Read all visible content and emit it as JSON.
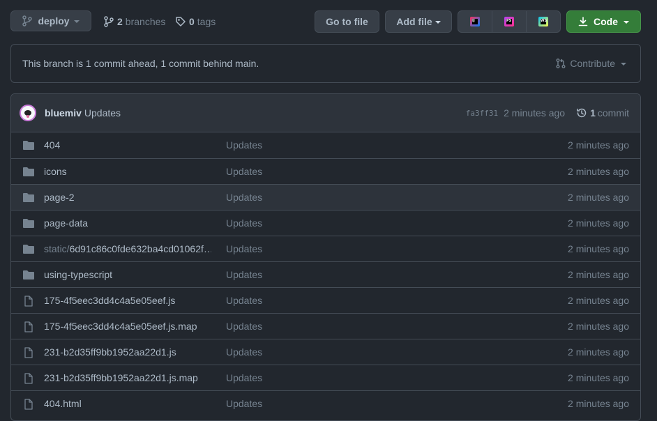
{
  "toolbar": {
    "branch_name": "deploy",
    "branches_count": "2",
    "branches_label": "branches",
    "tags_count": "0",
    "tags_label": "tags",
    "go_to_file": "Go to file",
    "add_file": "Add file",
    "code": "Code",
    "ides": [
      {
        "label": "IJ",
        "color": "#fe315d"
      },
      {
        "label": "PS",
        "color": "#b345f1"
      },
      {
        "label": "WS",
        "color": "#07c3f2"
      }
    ]
  },
  "branch_status": {
    "text": "This branch is 1 commit ahead, 1 commit behind main.",
    "contribute": "Contribute"
  },
  "latest_commit": {
    "author": "bluemiv",
    "message": "Updates",
    "sha": "fa3ff31",
    "age": "2 minutes ago",
    "commit_count": "1",
    "commit_label": "commit"
  },
  "files": [
    {
      "type": "dir",
      "prefix": "",
      "name": "404",
      "message": "Updates",
      "age": "2 minutes ago"
    },
    {
      "type": "dir",
      "prefix": "",
      "name": "icons",
      "message": "Updates",
      "age": "2 minutes ago"
    },
    {
      "type": "dir",
      "prefix": "",
      "name": "page-2",
      "message": "Updates",
      "age": "2 minutes ago"
    },
    {
      "type": "dir",
      "prefix": "",
      "name": "page-data",
      "message": "Updates",
      "age": "2 minutes ago"
    },
    {
      "type": "dir",
      "prefix": "static/",
      "name": "6d91c86c0fde632ba4cd01062f…",
      "message": "Updates",
      "age": "2 minutes ago"
    },
    {
      "type": "dir",
      "prefix": "",
      "name": "using-typescript",
      "message": "Updates",
      "age": "2 minutes ago"
    },
    {
      "type": "file",
      "prefix": "",
      "name": "175-4f5eec3dd4c4a5e05eef.js",
      "message": "Updates",
      "age": "2 minutes ago"
    },
    {
      "type": "file",
      "prefix": "",
      "name": "175-4f5eec3dd4c4a5e05eef.js.map",
      "message": "Updates",
      "age": "2 minutes ago"
    },
    {
      "type": "file",
      "prefix": "",
      "name": "231-b2d35ff9bb1952aa22d1.js",
      "message": "Updates",
      "age": "2 minutes ago"
    },
    {
      "type": "file",
      "prefix": "",
      "name": "231-b2d35ff9bb1952aa22d1.js.map",
      "message": "Updates",
      "age": "2 minutes ago"
    },
    {
      "type": "file",
      "prefix": "",
      "name": "404.html",
      "message": "Updates",
      "age": "2 minutes ago"
    }
  ],
  "colors": {
    "background": "#22272e",
    "border": "#444c56",
    "muted_text": "#768390",
    "code_button": "#347d39",
    "folder_icon": "#768390"
  }
}
